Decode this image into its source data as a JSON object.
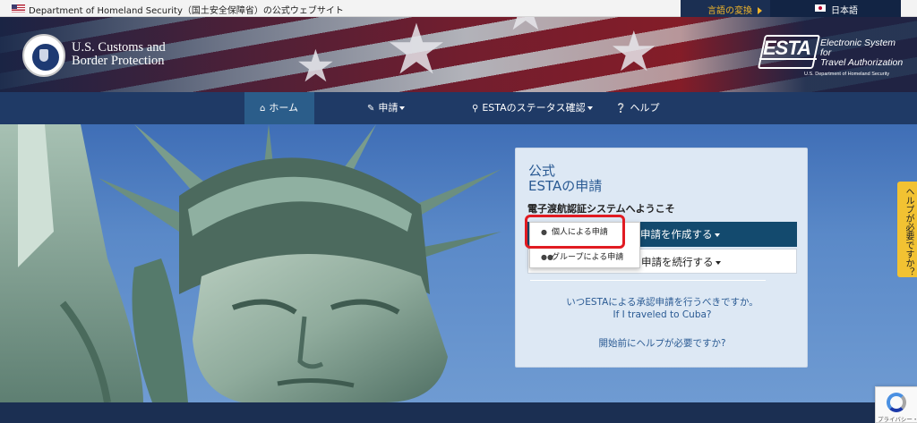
{
  "gov_bar": {
    "site_text": "Department of Homeland Security（国土安全保障省）の公式ウェブサイト",
    "language_change": "言語の変換",
    "current_language": "日本語"
  },
  "header": {
    "agency_line1": "U.S. Customs and",
    "agency_line2": "Border Protection",
    "esta_word": "ESTA",
    "esta_line1": "Electronic System for",
    "esta_line2": "Travel Authorization",
    "esta_sub": "U.S. Department of Homeland Security"
  },
  "nav": {
    "items": [
      {
        "label": "ホーム",
        "icon": "home-icon"
      },
      {
        "label": "申請",
        "icon": "pencil-icon"
      },
      {
        "label": "ESTAのステータス確認",
        "icon": "search-icon"
      },
      {
        "label": "ヘルプ",
        "icon": "question-circle-icon"
      }
    ]
  },
  "card": {
    "title_line1": "公式",
    "title_line2": "ESTAの申請",
    "welcome": "電子渡航認証システムへようこそ",
    "create_label": "申請を作成する",
    "continue_label": "申請を続行する",
    "links": [
      "いつESTAによる承認申請を行うべきですか。",
      "If I traveled to Cuba?",
      "開始前にヘルプが必要ですか?"
    ]
  },
  "dropdown": {
    "items": [
      {
        "label": "個人による申請",
        "icon": "user-icon"
      },
      {
        "label": "グループによる申請",
        "icon": "users-icon"
      }
    ]
  },
  "help_tab": "ヘルプが必要ですか？",
  "recaptcha_text": "プライバシー・利用規約",
  "colors": {
    "nav_bg": "#1f3a66",
    "nav_active": "#2b5d8a",
    "primary_button": "#134a6e",
    "link": "#2a5a93",
    "highlight": "#e11b22",
    "help_tab": "#f2c232"
  }
}
